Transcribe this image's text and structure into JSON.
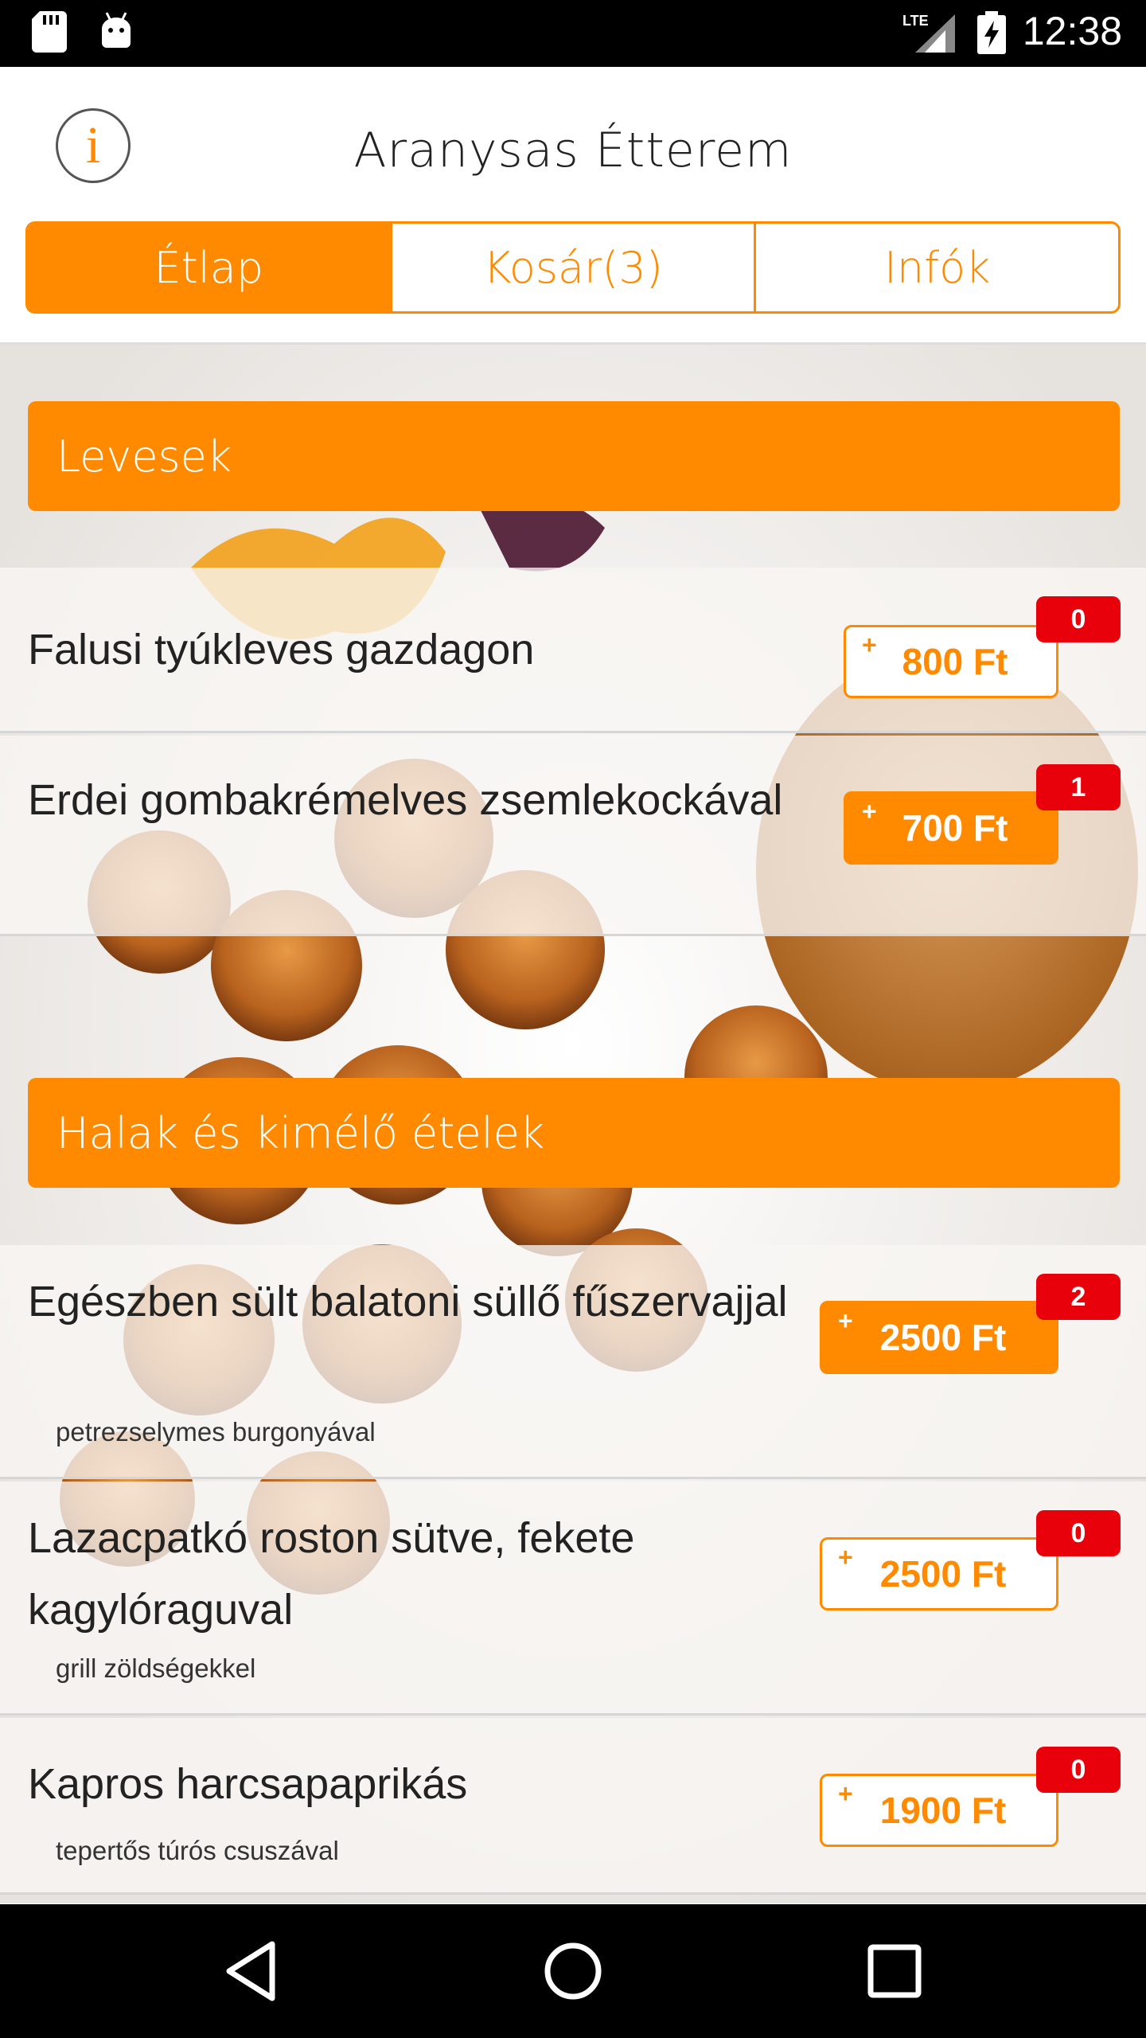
{
  "status_bar": {
    "time": "12:38",
    "network": "LTE",
    "icons": [
      "sd-card-icon",
      "android-icon",
      "lte-signal-icon",
      "battery-charging-icon"
    ]
  },
  "header": {
    "title": "Aranysas Étterem",
    "info_icon_glyph": "i"
  },
  "tabs": [
    {
      "label": "Étlap",
      "active": true
    },
    {
      "label": "Kosár(3)",
      "active": false
    },
    {
      "label": "Infók",
      "active": false
    }
  ],
  "categories": [
    {
      "label": "Levesek",
      "items": [
        {
          "name": "Falusi tyúkleves gazdagon",
          "subtitle": "",
          "price": "800 Ft",
          "count": "0",
          "plus": "+"
        },
        {
          "name": "Erdei gombakrémelves zsemlekockával",
          "subtitle": "",
          "price": "700 Ft",
          "count": "1",
          "plus": "+"
        }
      ]
    },
    {
      "label": "Halak és kimélő ételek",
      "items": [
        {
          "name": "Egészben sült balatoni süllő fűszervajjal",
          "subtitle": "petrezselymes burgonyával",
          "price": "2500 Ft",
          "count": "2",
          "plus": "+"
        },
        {
          "name": "Lazacpatkó roston sütve, fekete kagylóraguval",
          "subtitle": "grill zöldségekkel",
          "price": "2500 Ft",
          "count": "0",
          "plus": "+"
        },
        {
          "name": "Kapros harcsapaprikás",
          "subtitle": "tepertős túrós csuszával",
          "price": "1900 Ft",
          "count": "0",
          "plus": "+"
        }
      ]
    }
  ],
  "colors": {
    "accent": "#ff8a00",
    "badge": "#e8000b",
    "text": "#222222"
  },
  "nav_bar": {
    "icons": [
      "back-icon",
      "home-icon",
      "recent-apps-icon"
    ]
  }
}
